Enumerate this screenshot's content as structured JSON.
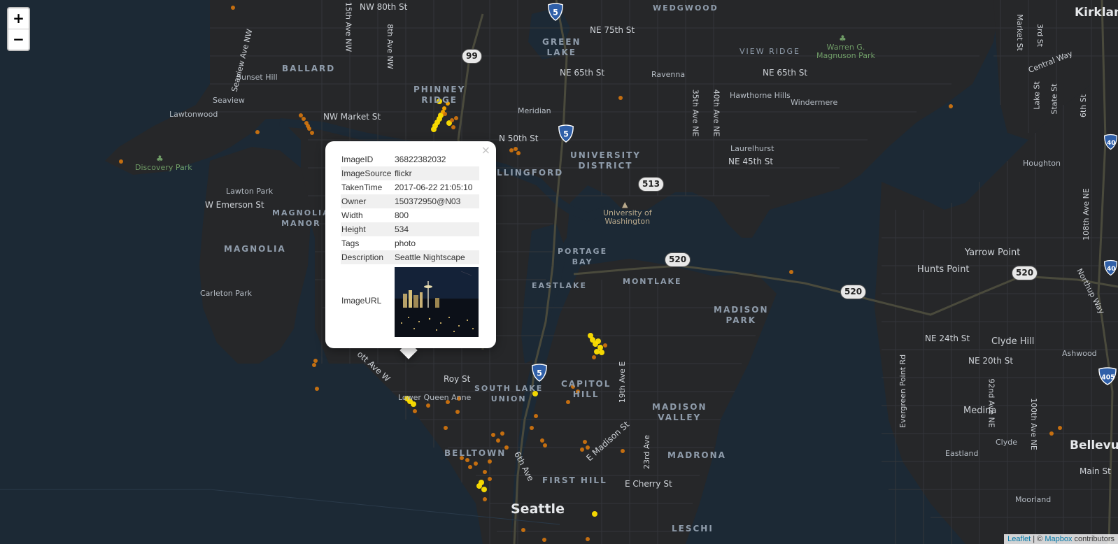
{
  "map": {
    "zoom_in_label": "+",
    "zoom_out_label": "−",
    "attribution": {
      "leaflet": "Leaflet",
      "separator": " | © ",
      "mapbox": "Mapbox",
      "suffix": " contributors"
    },
    "labels": {
      "nw80": "NW 80th St",
      "wedgwood": "WEDGWOOD",
      "ne75": "NE 75th St",
      "kirkland": "Kirkland",
      "greenlake": "GREEN\nLAKE",
      "ballard": "BALLARD",
      "sunset_hill": "Sunset Hill",
      "seaview_ave": "Seaview Ave NW",
      "fifteenth": "15th Ave NW",
      "eighth": "8th Ave NW",
      "view_ridge": "VIEW RIDGE",
      "magnuson": "Warren G.\nMagnuson Park",
      "market": "Market St",
      "third": "3rd St",
      "central_way": "Central Way",
      "ne65_a": "NE 65th St",
      "ravenna": "Ravenna",
      "ne65_b": "NE 65th St",
      "seaview": "Seaview",
      "phinney": "PHINNEY\nRIDGE",
      "hawthorne": "Hawthorne Hills",
      "windermere": "Windermere",
      "lawtonwood": "Lawtonwood",
      "nw_market": "NW Market St",
      "meridian": "Meridian",
      "ave35": "35th Ave NE",
      "ave40": "40th Ave NE",
      "n50": "N 50th St",
      "laurelhurst": "Laurelhurst",
      "ne45": "NE 45th St",
      "university_district": "UNIVERSITY\nDISTRICT",
      "discovery_park": "Discovery Park",
      "wallingford": "LLINGFORD",
      "houghton": "Houghton",
      "lawton_park": "Lawton Park",
      "w_emerson": "W Emerson St",
      "magnolia_manor": "MAGNOLIA\nMANOR",
      "uw": "University of\nWashington",
      "magnolia": "MAGNOLIA",
      "portage_bay": "PORTAGE\nBAY",
      "yarrow_point": "Yarrow Point",
      "hunts_point": "Hunts Point",
      "eastlake": "EASTLAKE",
      "montlake": "MONTLAKE",
      "carleton_park": "Carleton Park",
      "madison_park": "MADISON\nPARK",
      "northup_way": "Northup Way",
      "ne24": "NE 24th St",
      "clyde_hill": "Clyde Hill",
      "ashwood": "Ashwood",
      "ne20": "NE 20th St",
      "elliott_ave": "ott Ave W",
      "roy": "Roy St",
      "slu": "SOUTH LAKE\nUNION",
      "capitol_hill": "CAPITOL\nHILL",
      "ave19": "19th Ave E",
      "evergreen": "Evergreen Point Rd",
      "ave92": "92nd Ave NE",
      "ave100": "100th Ave NE",
      "lower_queen_anne": "Lower Queen Anne",
      "madison_valley": "MADISON\nVALLEY",
      "medina": "Medina",
      "e_madison": "E Madison St",
      "ave23": "23rd Ave",
      "clyde": "Clyde",
      "belltown": "BELLTOWN",
      "madrona": "MADRONA",
      "eastland": "Eastland",
      "bellevue": "Bellevue",
      "ave6": "6th Ave",
      "first_hill": "FIRST HILL",
      "e_cherry": "E Cherry St",
      "main": "Main St",
      "moorland": "Moorland",
      "seattle": "Seattle",
      "leschi": "LESCHI",
      "lake": "Lake St",
      "state": "State St",
      "sixth_st": "6th St",
      "ave108": "108th Ave NE"
    },
    "shields": {
      "i5_a": "5",
      "i5_b": "5",
      "i5_c": "5",
      "sr99": "99",
      "sr513": "513",
      "sr520_a": "520",
      "sr520_b": "520",
      "sr520_c": "520",
      "i405": "405",
      "i405_b": "40",
      "i405_c": "40"
    },
    "points": {
      "colors": {
        "orange": "#e07b0c",
        "yellow": "#ffe000",
        "amber": "#f7a800"
      }
    }
  },
  "popup": {
    "close_label": "×",
    "rows": [
      {
        "key": "ImageID",
        "value": "36822382032"
      },
      {
        "key": "ImageSource",
        "value": "flickr"
      },
      {
        "key": "TakenTime",
        "value": "2017-06-22 21:05:10"
      },
      {
        "key": "Owner",
        "value": "150372950@N03"
      },
      {
        "key": "Width",
        "value": "800"
      },
      {
        "key": "Height",
        "value": "534"
      },
      {
        "key": "Tags",
        "value": "photo"
      },
      {
        "key": "Description",
        "value": "Seattle Nightscape"
      }
    ],
    "image_row_key": "ImageURL"
  }
}
